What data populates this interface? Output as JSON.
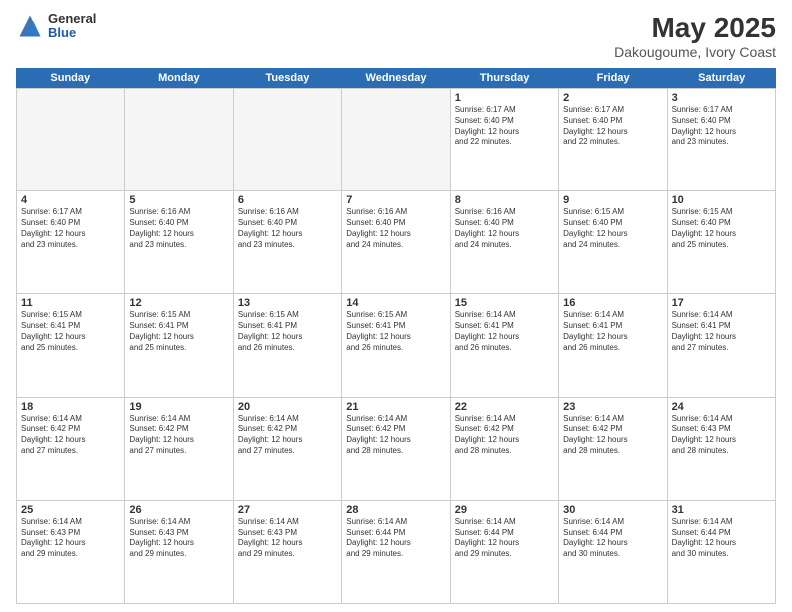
{
  "logo": {
    "general": "General",
    "blue": "Blue"
  },
  "title": "May 2025",
  "subtitle": "Dakougoume, Ivory Coast",
  "days": [
    "Sunday",
    "Monday",
    "Tuesday",
    "Wednesday",
    "Thursday",
    "Friday",
    "Saturday"
  ],
  "weeks": [
    [
      {
        "day": "",
        "empty": true
      },
      {
        "day": "",
        "empty": true
      },
      {
        "day": "",
        "empty": true
      },
      {
        "day": "",
        "empty": true
      },
      {
        "day": "1",
        "sunrise": "Sunrise: 6:17 AM",
        "sunset": "Sunset: 6:40 PM",
        "daylight": "Daylight: 12 hours",
        "extra": "and 22 minutes."
      },
      {
        "day": "2",
        "sunrise": "Sunrise: 6:17 AM",
        "sunset": "Sunset: 6:40 PM",
        "daylight": "Daylight: 12 hours",
        "extra": "and 22 minutes."
      },
      {
        "day": "3",
        "sunrise": "Sunrise: 6:17 AM",
        "sunset": "Sunset: 6:40 PM",
        "daylight": "Daylight: 12 hours",
        "extra": "and 23 minutes."
      }
    ],
    [
      {
        "day": "4",
        "sunrise": "Sunrise: 6:17 AM",
        "sunset": "Sunset: 6:40 PM",
        "daylight": "Daylight: 12 hours",
        "extra": "and 23 minutes."
      },
      {
        "day": "5",
        "sunrise": "Sunrise: 6:16 AM",
        "sunset": "Sunset: 6:40 PM",
        "daylight": "Daylight: 12 hours",
        "extra": "and 23 minutes."
      },
      {
        "day": "6",
        "sunrise": "Sunrise: 6:16 AM",
        "sunset": "Sunset: 6:40 PM",
        "daylight": "Daylight: 12 hours",
        "extra": "and 23 minutes."
      },
      {
        "day": "7",
        "sunrise": "Sunrise: 6:16 AM",
        "sunset": "Sunset: 6:40 PM",
        "daylight": "Daylight: 12 hours",
        "extra": "and 24 minutes."
      },
      {
        "day": "8",
        "sunrise": "Sunrise: 6:16 AM",
        "sunset": "Sunset: 6:40 PM",
        "daylight": "Daylight: 12 hours",
        "extra": "and 24 minutes."
      },
      {
        "day": "9",
        "sunrise": "Sunrise: 6:15 AM",
        "sunset": "Sunset: 6:40 PM",
        "daylight": "Daylight: 12 hours",
        "extra": "and 24 minutes."
      },
      {
        "day": "10",
        "sunrise": "Sunrise: 6:15 AM",
        "sunset": "Sunset: 6:40 PM",
        "daylight": "Daylight: 12 hours",
        "extra": "and 25 minutes."
      }
    ],
    [
      {
        "day": "11",
        "sunrise": "Sunrise: 6:15 AM",
        "sunset": "Sunset: 6:41 PM",
        "daylight": "Daylight: 12 hours",
        "extra": "and 25 minutes."
      },
      {
        "day": "12",
        "sunrise": "Sunrise: 6:15 AM",
        "sunset": "Sunset: 6:41 PM",
        "daylight": "Daylight: 12 hours",
        "extra": "and 25 minutes."
      },
      {
        "day": "13",
        "sunrise": "Sunrise: 6:15 AM",
        "sunset": "Sunset: 6:41 PM",
        "daylight": "Daylight: 12 hours",
        "extra": "and 26 minutes."
      },
      {
        "day": "14",
        "sunrise": "Sunrise: 6:15 AM",
        "sunset": "Sunset: 6:41 PM",
        "daylight": "Daylight: 12 hours",
        "extra": "and 26 minutes."
      },
      {
        "day": "15",
        "sunrise": "Sunrise: 6:14 AM",
        "sunset": "Sunset: 6:41 PM",
        "daylight": "Daylight: 12 hours",
        "extra": "and 26 minutes."
      },
      {
        "day": "16",
        "sunrise": "Sunrise: 6:14 AM",
        "sunset": "Sunset: 6:41 PM",
        "daylight": "Daylight: 12 hours",
        "extra": "and 26 minutes."
      },
      {
        "day": "17",
        "sunrise": "Sunrise: 6:14 AM",
        "sunset": "Sunset: 6:41 PM",
        "daylight": "Daylight: 12 hours",
        "extra": "and 27 minutes."
      }
    ],
    [
      {
        "day": "18",
        "sunrise": "Sunrise: 6:14 AM",
        "sunset": "Sunset: 6:42 PM",
        "daylight": "Daylight: 12 hours",
        "extra": "and 27 minutes."
      },
      {
        "day": "19",
        "sunrise": "Sunrise: 6:14 AM",
        "sunset": "Sunset: 6:42 PM",
        "daylight": "Daylight: 12 hours",
        "extra": "and 27 minutes."
      },
      {
        "day": "20",
        "sunrise": "Sunrise: 6:14 AM",
        "sunset": "Sunset: 6:42 PM",
        "daylight": "Daylight: 12 hours",
        "extra": "and 27 minutes."
      },
      {
        "day": "21",
        "sunrise": "Sunrise: 6:14 AM",
        "sunset": "Sunset: 6:42 PM",
        "daylight": "Daylight: 12 hours",
        "extra": "and 28 minutes."
      },
      {
        "day": "22",
        "sunrise": "Sunrise: 6:14 AM",
        "sunset": "Sunset: 6:42 PM",
        "daylight": "Daylight: 12 hours",
        "extra": "and 28 minutes."
      },
      {
        "day": "23",
        "sunrise": "Sunrise: 6:14 AM",
        "sunset": "Sunset: 6:42 PM",
        "daylight": "Daylight: 12 hours",
        "extra": "and 28 minutes."
      },
      {
        "day": "24",
        "sunrise": "Sunrise: 6:14 AM",
        "sunset": "Sunset: 6:43 PM",
        "daylight": "Daylight: 12 hours",
        "extra": "and 28 minutes."
      }
    ],
    [
      {
        "day": "25",
        "sunrise": "Sunrise: 6:14 AM",
        "sunset": "Sunset: 6:43 PM",
        "daylight": "Daylight: 12 hours",
        "extra": "and 29 minutes."
      },
      {
        "day": "26",
        "sunrise": "Sunrise: 6:14 AM",
        "sunset": "Sunset: 6:43 PM",
        "daylight": "Daylight: 12 hours",
        "extra": "and 29 minutes."
      },
      {
        "day": "27",
        "sunrise": "Sunrise: 6:14 AM",
        "sunset": "Sunset: 6:43 PM",
        "daylight": "Daylight: 12 hours",
        "extra": "and 29 minutes."
      },
      {
        "day": "28",
        "sunrise": "Sunrise: 6:14 AM",
        "sunset": "Sunset: 6:44 PM",
        "daylight": "Daylight: 12 hours",
        "extra": "and 29 minutes."
      },
      {
        "day": "29",
        "sunrise": "Sunrise: 6:14 AM",
        "sunset": "Sunset: 6:44 PM",
        "daylight": "Daylight: 12 hours",
        "extra": "and 29 minutes."
      },
      {
        "day": "30",
        "sunrise": "Sunrise: 6:14 AM",
        "sunset": "Sunset: 6:44 PM",
        "daylight": "Daylight: 12 hours",
        "extra": "and 30 minutes."
      },
      {
        "day": "31",
        "sunrise": "Sunrise: 6:14 AM",
        "sunset": "Sunset: 6:44 PM",
        "daylight": "Daylight: 12 hours",
        "extra": "and 30 minutes."
      }
    ]
  ]
}
